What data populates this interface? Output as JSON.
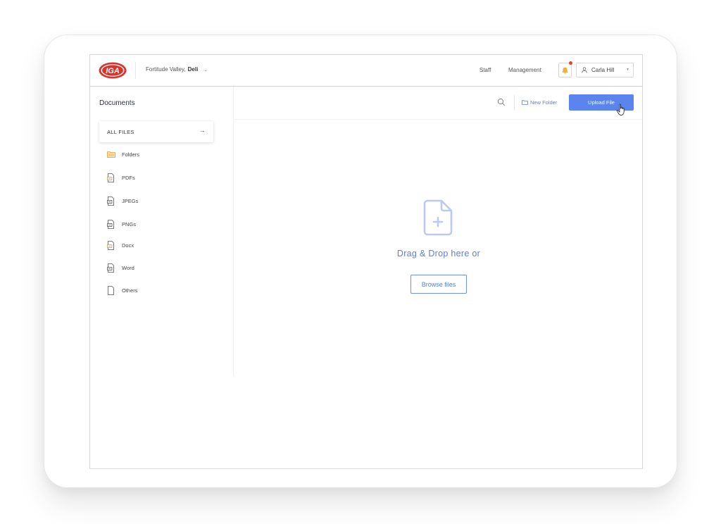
{
  "header": {
    "logo_text": "IGA",
    "store_name": "Fortitude Valley,",
    "store_dept": "Deli",
    "nav": [
      {
        "label": "Staff"
      },
      {
        "label": "Management"
      }
    ],
    "user_name": "Carla Hill"
  },
  "sidebar": {
    "title": "Documents",
    "all_files_label": "ALL FILES",
    "items": [
      {
        "label": "Folders",
        "icon": "folder-icon"
      },
      {
        "label": "PDFs",
        "icon": "file-icon"
      },
      {
        "label": "JPEGs",
        "icon": "file-icon"
      },
      {
        "label": "PNGs",
        "icon": "file-icon"
      },
      {
        "label": "Docx",
        "icon": "file-icon"
      },
      {
        "label": "Word",
        "icon": "file-icon"
      },
      {
        "label": "Others",
        "icon": "blank-file-icon"
      }
    ]
  },
  "toolbar": {
    "new_folder_label": "New Folder",
    "upload_label": "Upload File"
  },
  "dropzone": {
    "prompt": "Drag & Drop here or",
    "browse_label": "Browse files"
  },
  "colors": {
    "accent": "#5b84ef",
    "accent_text": "#5b7fe0",
    "brand_red": "#d6342c",
    "icon_orange": "#e59a2b",
    "notification": "#e0452e"
  }
}
